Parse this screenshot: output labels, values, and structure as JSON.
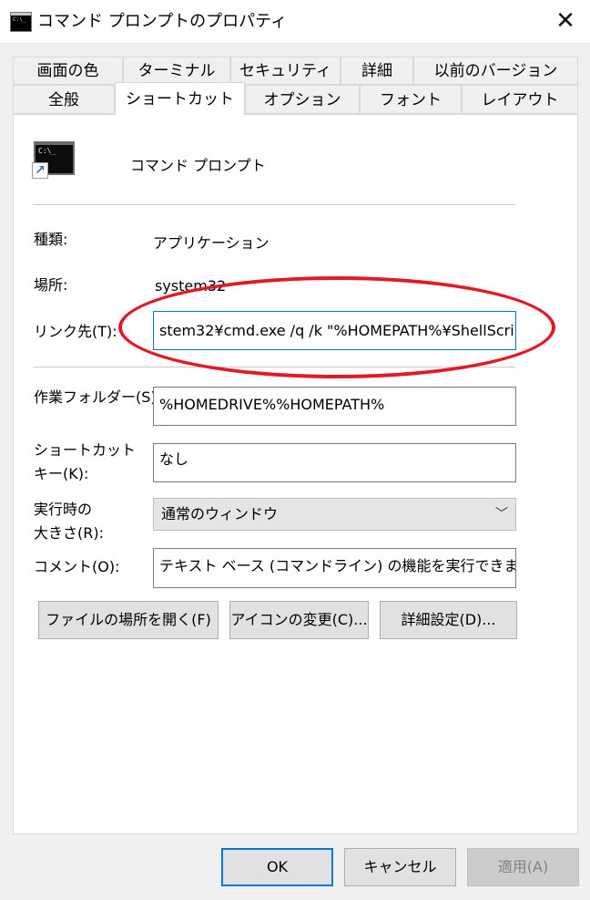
{
  "window": {
    "title": "コマンド プロンプトのプロパティ",
    "close_glyph": "✕",
    "icon_text": "C:\\_"
  },
  "tabs": {
    "row1": [
      "画面の色",
      "ターミナル",
      "セキュリティ",
      "詳細",
      "以前のバージョン"
    ],
    "row2": [
      "全般",
      "ショートカット",
      "オプション",
      "フォント",
      "レイアウト"
    ],
    "active": "ショートカット"
  },
  "shortcut": {
    "icon_text": "C:\\_",
    "arrow_glyph": "↗",
    "name": "コマンド プロンプト",
    "type_label": "種類:",
    "type_value": "アプリケーション",
    "location_label": "場所:",
    "location_value": "system32",
    "target_label": "リンク先(T):",
    "target_value": "stem32¥cmd.exe /q /k \"%HOMEPATH%¥ShellScri",
    "workdir_label": "作業フォルダー(S):",
    "workdir_value": "%HOMEDRIVE%%HOMEPATH%",
    "hotkey_label_line1": "ショートカット",
    "hotkey_label_line2": "キー(K):",
    "hotkey_value": "なし",
    "size_label_line1": "実行時の",
    "size_label_line2": "大きさ(R):",
    "size_value": "通常のウィンドウ",
    "comment_label": "コメント(O):",
    "comment_value": "テキスト ベース (コマンドライン) の機能を実行できます。"
  },
  "buttons": {
    "open_location": "ファイルの場所を開く(F)",
    "change_icon": "アイコンの変更(C)...",
    "advanced": "詳細設定(D)...",
    "ok": "OK",
    "cancel": "キャンセル",
    "apply": "適用(A)"
  },
  "colors": {
    "highlight": "#e21a26",
    "focus": "#0078d7"
  }
}
